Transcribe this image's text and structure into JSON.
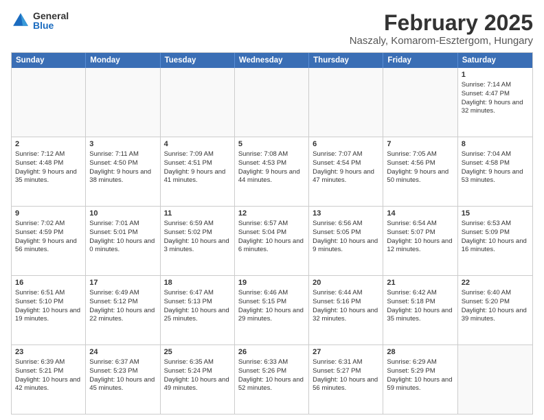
{
  "logo": {
    "general": "General",
    "blue": "Blue"
  },
  "header": {
    "title": "February 2025",
    "subtitle": "Naszaly, Komarom-Esztergom, Hungary"
  },
  "weekdays": [
    "Sunday",
    "Monday",
    "Tuesday",
    "Wednesday",
    "Thursday",
    "Friday",
    "Saturday"
  ],
  "rows": [
    [
      {
        "day": "",
        "info": "",
        "empty": true
      },
      {
        "day": "",
        "info": "",
        "empty": true
      },
      {
        "day": "",
        "info": "",
        "empty": true
      },
      {
        "day": "",
        "info": "",
        "empty": true
      },
      {
        "day": "",
        "info": "",
        "empty": true
      },
      {
        "day": "",
        "info": "",
        "empty": true
      },
      {
        "day": "1",
        "info": "Sunrise: 7:14 AM\nSunset: 4:47 PM\nDaylight: 9 hours and 32 minutes."
      }
    ],
    [
      {
        "day": "2",
        "info": "Sunrise: 7:12 AM\nSunset: 4:48 PM\nDaylight: 9 hours and 35 minutes."
      },
      {
        "day": "3",
        "info": "Sunrise: 7:11 AM\nSunset: 4:50 PM\nDaylight: 9 hours and 38 minutes."
      },
      {
        "day": "4",
        "info": "Sunrise: 7:09 AM\nSunset: 4:51 PM\nDaylight: 9 hours and 41 minutes."
      },
      {
        "day": "5",
        "info": "Sunrise: 7:08 AM\nSunset: 4:53 PM\nDaylight: 9 hours and 44 minutes."
      },
      {
        "day": "6",
        "info": "Sunrise: 7:07 AM\nSunset: 4:54 PM\nDaylight: 9 hours and 47 minutes."
      },
      {
        "day": "7",
        "info": "Sunrise: 7:05 AM\nSunset: 4:56 PM\nDaylight: 9 hours and 50 minutes."
      },
      {
        "day": "8",
        "info": "Sunrise: 7:04 AM\nSunset: 4:58 PM\nDaylight: 9 hours and 53 minutes."
      }
    ],
    [
      {
        "day": "9",
        "info": "Sunrise: 7:02 AM\nSunset: 4:59 PM\nDaylight: 9 hours and 56 minutes."
      },
      {
        "day": "10",
        "info": "Sunrise: 7:01 AM\nSunset: 5:01 PM\nDaylight: 10 hours and 0 minutes."
      },
      {
        "day": "11",
        "info": "Sunrise: 6:59 AM\nSunset: 5:02 PM\nDaylight: 10 hours and 3 minutes."
      },
      {
        "day": "12",
        "info": "Sunrise: 6:57 AM\nSunset: 5:04 PM\nDaylight: 10 hours and 6 minutes."
      },
      {
        "day": "13",
        "info": "Sunrise: 6:56 AM\nSunset: 5:05 PM\nDaylight: 10 hours and 9 minutes."
      },
      {
        "day": "14",
        "info": "Sunrise: 6:54 AM\nSunset: 5:07 PM\nDaylight: 10 hours and 12 minutes."
      },
      {
        "day": "15",
        "info": "Sunrise: 6:53 AM\nSunset: 5:09 PM\nDaylight: 10 hours and 16 minutes."
      }
    ],
    [
      {
        "day": "16",
        "info": "Sunrise: 6:51 AM\nSunset: 5:10 PM\nDaylight: 10 hours and 19 minutes."
      },
      {
        "day": "17",
        "info": "Sunrise: 6:49 AM\nSunset: 5:12 PM\nDaylight: 10 hours and 22 minutes."
      },
      {
        "day": "18",
        "info": "Sunrise: 6:47 AM\nSunset: 5:13 PM\nDaylight: 10 hours and 25 minutes."
      },
      {
        "day": "19",
        "info": "Sunrise: 6:46 AM\nSunset: 5:15 PM\nDaylight: 10 hours and 29 minutes."
      },
      {
        "day": "20",
        "info": "Sunrise: 6:44 AM\nSunset: 5:16 PM\nDaylight: 10 hours and 32 minutes."
      },
      {
        "day": "21",
        "info": "Sunrise: 6:42 AM\nSunset: 5:18 PM\nDaylight: 10 hours and 35 minutes."
      },
      {
        "day": "22",
        "info": "Sunrise: 6:40 AM\nSunset: 5:20 PM\nDaylight: 10 hours and 39 minutes."
      }
    ],
    [
      {
        "day": "23",
        "info": "Sunrise: 6:39 AM\nSunset: 5:21 PM\nDaylight: 10 hours and 42 minutes."
      },
      {
        "day": "24",
        "info": "Sunrise: 6:37 AM\nSunset: 5:23 PM\nDaylight: 10 hours and 45 minutes."
      },
      {
        "day": "25",
        "info": "Sunrise: 6:35 AM\nSunset: 5:24 PM\nDaylight: 10 hours and 49 minutes."
      },
      {
        "day": "26",
        "info": "Sunrise: 6:33 AM\nSunset: 5:26 PM\nDaylight: 10 hours and 52 minutes."
      },
      {
        "day": "27",
        "info": "Sunrise: 6:31 AM\nSunset: 5:27 PM\nDaylight: 10 hours and 56 minutes."
      },
      {
        "day": "28",
        "info": "Sunrise: 6:29 AM\nSunset: 5:29 PM\nDaylight: 10 hours and 59 minutes."
      },
      {
        "day": "",
        "info": "",
        "empty": true
      }
    ]
  ]
}
